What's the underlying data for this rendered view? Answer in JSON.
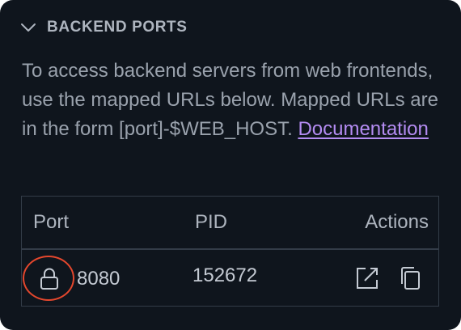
{
  "section": {
    "title": "BACKEND PORTS",
    "chevron_icon": "chevron-down-icon"
  },
  "description": {
    "text": "To access backend servers from web frontends, use the mapped URLs below. Mapped URLs are in the form [port]-$WEB_HOST. ",
    "link_label": "Documentation"
  },
  "table": {
    "headers": {
      "port": "Port",
      "pid": "PID",
      "actions": "Actions"
    },
    "rows": [
      {
        "port": "8080",
        "pid": "152672",
        "status_icon": "lock-icon",
        "actions": [
          "open-external-icon",
          "copy-icon"
        ]
      }
    ]
  },
  "colors": {
    "background": "#0f151d",
    "text": "#c4cad3",
    "muted_text": "#9aa2ad",
    "link": "#b48cf2",
    "border": "#333c48",
    "highlight_ring": "#e4472d"
  }
}
